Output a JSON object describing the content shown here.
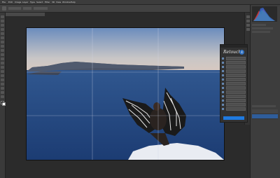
{
  "menubar": {
    "items": [
      "File",
      "Edit",
      "Image",
      "Layer",
      "Type",
      "Select",
      "Filter",
      "3D",
      "View",
      "Window",
      "Help"
    ]
  },
  "document": {
    "tab_title": ""
  },
  "plugin": {
    "title": "",
    "logo": "Retouch",
    "badge": "4",
    "radio_count": 13,
    "buttons": [
      "",
      "",
      "",
      "",
      "",
      "",
      "",
      "",
      "",
      "",
      "",
      "",
      ""
    ],
    "apply_label": ""
  },
  "colors": {
    "app_bg": "#2b2b2b",
    "panel_bg": "#3d3d3d",
    "accent": "#1f7ae0",
    "sky_top": "#6e8fbf",
    "sea": "#23457f"
  },
  "icons": {
    "toolbar": [
      "move-icon",
      "marquee-icon",
      "lasso-icon",
      "quick-select-icon",
      "crop-icon",
      "eyedropper-icon",
      "healing-icon",
      "brush-icon",
      "stamp-icon",
      "history-brush-icon",
      "eraser-icon",
      "gradient-icon",
      "blur-icon",
      "dodge-icon",
      "pen-icon",
      "type-icon",
      "path-select-icon",
      "shape-icon",
      "hand-icon",
      "zoom-icon"
    ]
  }
}
